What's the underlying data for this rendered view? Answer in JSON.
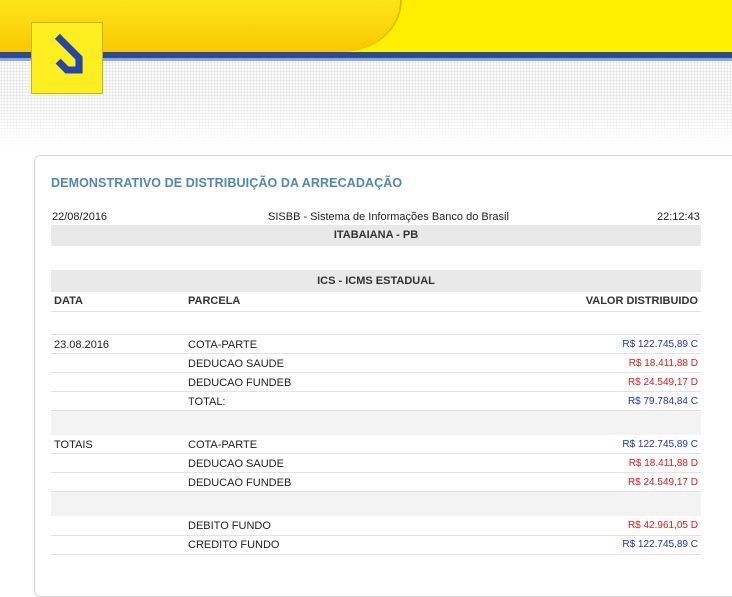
{
  "header": {
    "logo_icon": "banco-do-brasil-logo-icon",
    "colors": {
      "yellow": "#ffef00",
      "blue": "#2a4a9c",
      "title": "#4f86b7",
      "positive": "#1a35c7",
      "negative": "#e01818"
    }
  },
  "report": {
    "title": "DEMONSTRATIVO DE DISTRIBUIÇÃO DA ARRECADAÇÃO",
    "date": "22/08/2016",
    "system": "SISBB - Sistema de Informações Banco do Brasil",
    "time": "22:12:43",
    "municipality": "ITABAIANA - PB",
    "tax": "ICS - ICMS ESTADUAL",
    "columns": {
      "date": "DATA",
      "parcel": "PARCELA",
      "value": "VALOR DISTRIBUIDO"
    },
    "rows": [
      {
        "date": "23.08.2016",
        "parcel": "COTA-PARTE",
        "value": "R$ 122.745,89 C"
      },
      {
        "date": "",
        "parcel": "DEDUCAO SAUDE",
        "value": "R$ 18.411,88 D"
      },
      {
        "date": "",
        "parcel": "DEDUCAO FUNDEB",
        "value": "R$ 24.549,17 D"
      },
      {
        "date": "",
        "parcel": "TOTAL:",
        "value": "R$ 79.784,84 C"
      }
    ],
    "totals_label": "TOTAIS",
    "totals": [
      {
        "parcel": "COTA-PARTE",
        "value": "R$ 122.745,89 C"
      },
      {
        "parcel": "DEDUCAO SAUDE",
        "value": "R$ 18.411,88 D"
      },
      {
        "parcel": "DEDUCAO FUNDEB",
        "value": "R$ 24.549,17 D"
      }
    ],
    "fund": [
      {
        "parcel": "DEBITO FUNDO",
        "value": "R$ 42.961,05 D"
      },
      {
        "parcel": "CREDITO FUNDO",
        "value": "R$ 122.745,89 C"
      }
    ]
  }
}
